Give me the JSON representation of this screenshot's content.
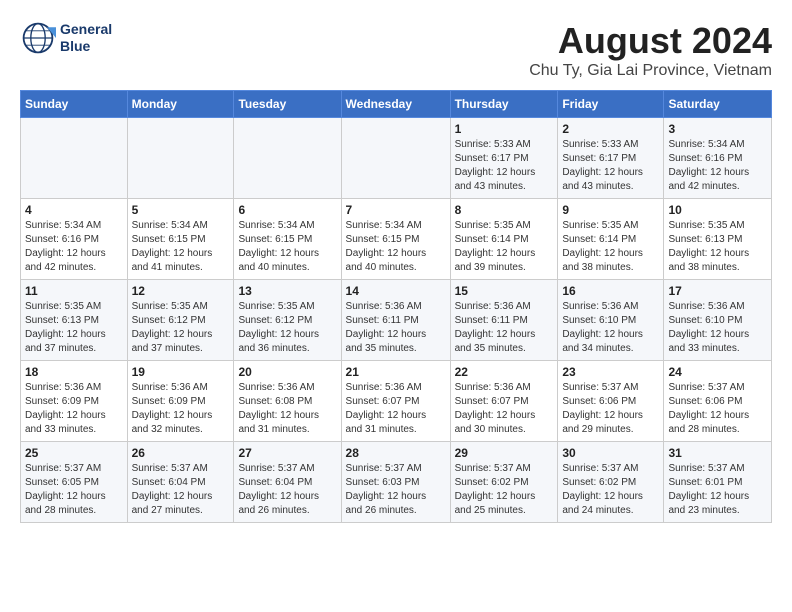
{
  "header": {
    "logo_line1": "General",
    "logo_line2": "Blue",
    "title": "August 2024",
    "subtitle": "Chu Ty, Gia Lai Province, Vietnam"
  },
  "days_of_week": [
    "Sunday",
    "Monday",
    "Tuesday",
    "Wednesday",
    "Thursday",
    "Friday",
    "Saturday"
  ],
  "weeks": [
    [
      {
        "day": "",
        "info": ""
      },
      {
        "day": "",
        "info": ""
      },
      {
        "day": "",
        "info": ""
      },
      {
        "day": "",
        "info": ""
      },
      {
        "day": "1",
        "info": "Sunrise: 5:33 AM\nSunset: 6:17 PM\nDaylight: 12 hours\nand 43 minutes."
      },
      {
        "day": "2",
        "info": "Sunrise: 5:33 AM\nSunset: 6:17 PM\nDaylight: 12 hours\nand 43 minutes."
      },
      {
        "day": "3",
        "info": "Sunrise: 5:34 AM\nSunset: 6:16 PM\nDaylight: 12 hours\nand 42 minutes."
      }
    ],
    [
      {
        "day": "4",
        "info": "Sunrise: 5:34 AM\nSunset: 6:16 PM\nDaylight: 12 hours\nand 42 minutes."
      },
      {
        "day": "5",
        "info": "Sunrise: 5:34 AM\nSunset: 6:15 PM\nDaylight: 12 hours\nand 41 minutes."
      },
      {
        "day": "6",
        "info": "Sunrise: 5:34 AM\nSunset: 6:15 PM\nDaylight: 12 hours\nand 40 minutes."
      },
      {
        "day": "7",
        "info": "Sunrise: 5:34 AM\nSunset: 6:15 PM\nDaylight: 12 hours\nand 40 minutes."
      },
      {
        "day": "8",
        "info": "Sunrise: 5:35 AM\nSunset: 6:14 PM\nDaylight: 12 hours\nand 39 minutes."
      },
      {
        "day": "9",
        "info": "Sunrise: 5:35 AM\nSunset: 6:14 PM\nDaylight: 12 hours\nand 38 minutes."
      },
      {
        "day": "10",
        "info": "Sunrise: 5:35 AM\nSunset: 6:13 PM\nDaylight: 12 hours\nand 38 minutes."
      }
    ],
    [
      {
        "day": "11",
        "info": "Sunrise: 5:35 AM\nSunset: 6:13 PM\nDaylight: 12 hours\nand 37 minutes."
      },
      {
        "day": "12",
        "info": "Sunrise: 5:35 AM\nSunset: 6:12 PM\nDaylight: 12 hours\nand 37 minutes."
      },
      {
        "day": "13",
        "info": "Sunrise: 5:35 AM\nSunset: 6:12 PM\nDaylight: 12 hours\nand 36 minutes."
      },
      {
        "day": "14",
        "info": "Sunrise: 5:36 AM\nSunset: 6:11 PM\nDaylight: 12 hours\nand 35 minutes."
      },
      {
        "day": "15",
        "info": "Sunrise: 5:36 AM\nSunset: 6:11 PM\nDaylight: 12 hours\nand 35 minutes."
      },
      {
        "day": "16",
        "info": "Sunrise: 5:36 AM\nSunset: 6:10 PM\nDaylight: 12 hours\nand 34 minutes."
      },
      {
        "day": "17",
        "info": "Sunrise: 5:36 AM\nSunset: 6:10 PM\nDaylight: 12 hours\nand 33 minutes."
      }
    ],
    [
      {
        "day": "18",
        "info": "Sunrise: 5:36 AM\nSunset: 6:09 PM\nDaylight: 12 hours\nand 33 minutes."
      },
      {
        "day": "19",
        "info": "Sunrise: 5:36 AM\nSunset: 6:09 PM\nDaylight: 12 hours\nand 32 minutes."
      },
      {
        "day": "20",
        "info": "Sunrise: 5:36 AM\nSunset: 6:08 PM\nDaylight: 12 hours\nand 31 minutes."
      },
      {
        "day": "21",
        "info": "Sunrise: 5:36 AM\nSunset: 6:07 PM\nDaylight: 12 hours\nand 31 minutes."
      },
      {
        "day": "22",
        "info": "Sunrise: 5:36 AM\nSunset: 6:07 PM\nDaylight: 12 hours\nand 30 minutes."
      },
      {
        "day": "23",
        "info": "Sunrise: 5:37 AM\nSunset: 6:06 PM\nDaylight: 12 hours\nand 29 minutes."
      },
      {
        "day": "24",
        "info": "Sunrise: 5:37 AM\nSunset: 6:06 PM\nDaylight: 12 hours\nand 28 minutes."
      }
    ],
    [
      {
        "day": "25",
        "info": "Sunrise: 5:37 AM\nSunset: 6:05 PM\nDaylight: 12 hours\nand 28 minutes."
      },
      {
        "day": "26",
        "info": "Sunrise: 5:37 AM\nSunset: 6:04 PM\nDaylight: 12 hours\nand 27 minutes."
      },
      {
        "day": "27",
        "info": "Sunrise: 5:37 AM\nSunset: 6:04 PM\nDaylight: 12 hours\nand 26 minutes."
      },
      {
        "day": "28",
        "info": "Sunrise: 5:37 AM\nSunset: 6:03 PM\nDaylight: 12 hours\nand 26 minutes."
      },
      {
        "day": "29",
        "info": "Sunrise: 5:37 AM\nSunset: 6:02 PM\nDaylight: 12 hours\nand 25 minutes."
      },
      {
        "day": "30",
        "info": "Sunrise: 5:37 AM\nSunset: 6:02 PM\nDaylight: 12 hours\nand 24 minutes."
      },
      {
        "day": "31",
        "info": "Sunrise: 5:37 AM\nSunset: 6:01 PM\nDaylight: 12 hours\nand 23 minutes."
      }
    ]
  ]
}
